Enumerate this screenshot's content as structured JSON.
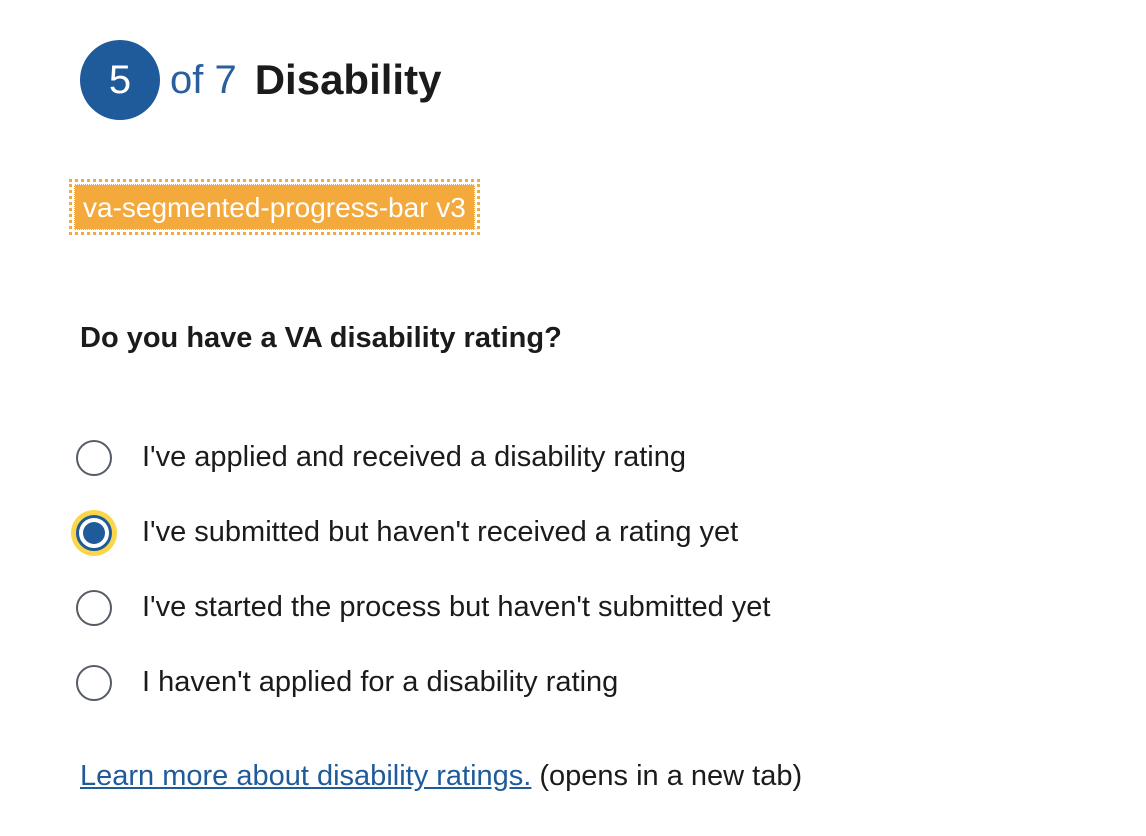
{
  "progress": {
    "current_step": "5",
    "of_text": "of 7",
    "step_title": "Disability"
  },
  "component_tag": "va-segmented-progress-bar v3",
  "question": "Do you have a VA disability rating?",
  "options": [
    {
      "label": "I've applied and received a disability rating",
      "checked": false
    },
    {
      "label": "I've submitted but haven't received a rating yet",
      "checked": true
    },
    {
      "label": "I've started the process but haven't submitted yet",
      "checked": false
    },
    {
      "label": "I haven't applied for a disability rating",
      "checked": false
    }
  ],
  "learn_more": {
    "link_text": "Learn more about disability ratings.",
    "suffix": "(opens in a new tab)"
  },
  "colors": {
    "primary": "#1f5a9a",
    "focus_ring": "#fad74a",
    "tag_background": "#f3a93c"
  }
}
